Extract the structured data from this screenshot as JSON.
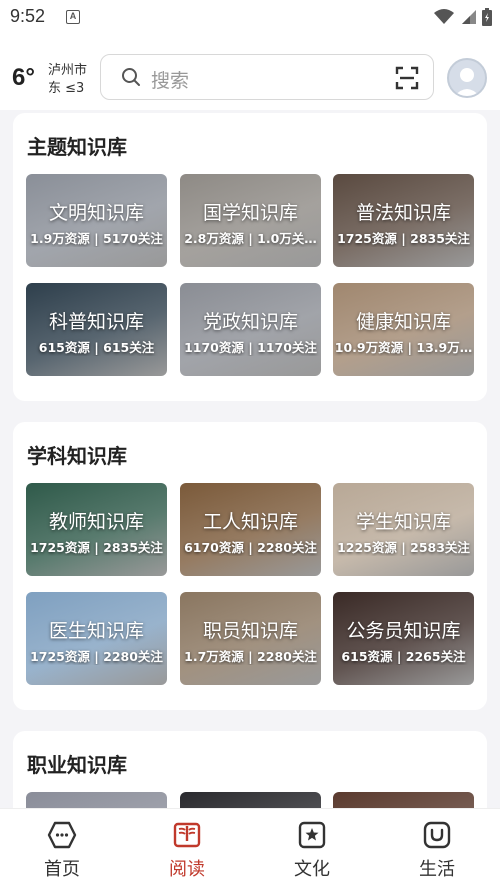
{
  "status_bar": {
    "time": "9:52",
    "app_icon_letter": "A"
  },
  "header": {
    "temperature": "6°",
    "city": "泸州市",
    "wind": "东 ≤3",
    "search_placeholder": "搜索"
  },
  "sections": [
    {
      "title": "主题知识库",
      "cards": [
        {
          "name": "文明知识库",
          "stats": "1.9万资源 | 5170关注",
          "color": "#8a8f98"
        },
        {
          "name": "国学知识库",
          "stats": "2.8万资源 | 1.0万关…",
          "color": "#8e8a85"
        },
        {
          "name": "普法知识库",
          "stats": "1725资源 | 2835关注",
          "color": "#5a4a40"
        },
        {
          "name": "科普知识库",
          "stats": "615资源 | 615关注",
          "color": "#2e3f4c"
        },
        {
          "name": "党政知识库",
          "stats": "1170资源 | 1170关注",
          "color": "#8a8d94"
        },
        {
          "name": "健康知识库",
          "stats": "10.9万资源 | 13.9万…",
          "color": "#a0876f"
        }
      ]
    },
    {
      "title": "学科知识库",
      "cards": [
        {
          "name": "教师知识库",
          "stats": "1725资源 | 2835关注",
          "color": "#2f5a4a"
        },
        {
          "name": "工人知识库",
          "stats": "6170资源 | 2280关注",
          "color": "#7b5a3a"
        },
        {
          "name": "学生知识库",
          "stats": "1225资源 | 2583关注",
          "color": "#b8a896"
        },
        {
          "name": "医生知识库",
          "stats": "1725资源 | 2280关注",
          "color": "#7fa0c0"
        },
        {
          "name": "职员知识库",
          "stats": "1.7万资源 | 2280关注",
          "color": "#8a7660"
        },
        {
          "name": "公务员知识库",
          "stats": "615资源 | 2265关注",
          "color": "#3a2a26"
        }
      ]
    },
    {
      "title": "职业知识库",
      "cards": [
        {
          "color": "#8a8d99"
        },
        {
          "color": "#2a2a2e"
        },
        {
          "color": "#5a3a2e"
        }
      ]
    }
  ],
  "bottom_nav": [
    {
      "label": "首页",
      "icon": "home-icon",
      "active": false
    },
    {
      "label": "阅读",
      "icon": "book-icon",
      "active": true
    },
    {
      "label": "文化",
      "icon": "star-badge-icon",
      "active": false
    },
    {
      "label": "生活",
      "icon": "bag-icon",
      "active": false
    }
  ],
  "colors": {
    "accent": "#c0392b",
    "background": "#f4f4f7"
  }
}
